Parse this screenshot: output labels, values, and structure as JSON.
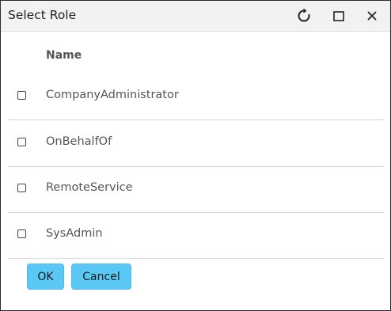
{
  "dialog": {
    "title": "Select Role",
    "controls": {
      "refresh_icon": "refresh-icon",
      "maximize_icon": "maximize-icon",
      "close_icon": "close-icon"
    }
  },
  "table": {
    "column_header": "Name",
    "rows": [
      {
        "label": "CompanyAdministrator",
        "checked": false
      },
      {
        "label": "OnBehalfOf",
        "checked": false
      },
      {
        "label": "RemoteService",
        "checked": false
      },
      {
        "label": "SysAdmin",
        "checked": false
      }
    ]
  },
  "buttons": {
    "ok_label": "OK",
    "cancel_label": "Cancel"
  },
  "colors": {
    "button_bg": "#5ac8f5",
    "titlebar_bg": "#f2f2f2"
  }
}
